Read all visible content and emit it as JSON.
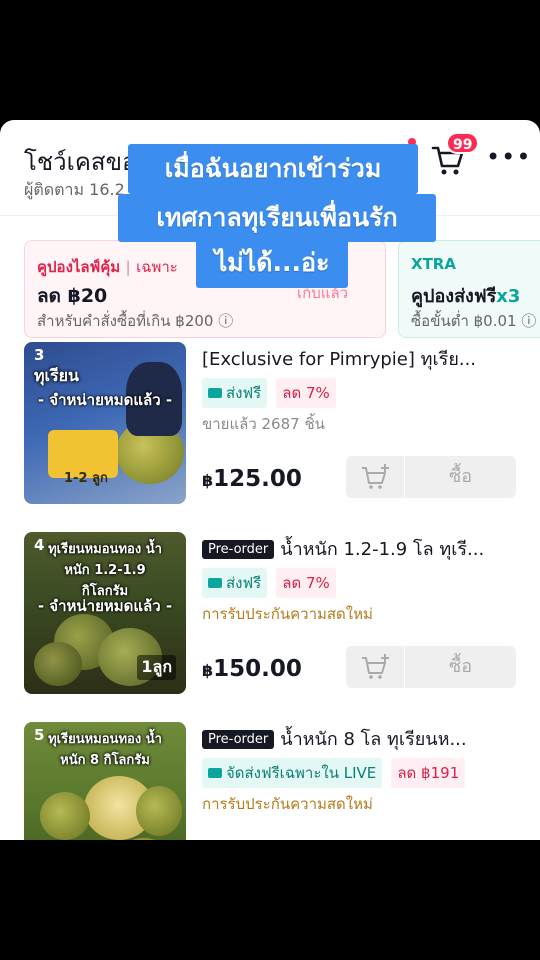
{
  "header": {
    "title": "โชว์เคสขอ",
    "followers": "ผู้ติดตาม 16.2",
    "cart_badge": "99"
  },
  "coupons": [
    {
      "tag": "คูปองไลฟ์คุ้ม",
      "tag2": "เฉพาะ",
      "main": "ลด ฿20",
      "note": "สำหรับคำสั่งซื้อที่เกิน ฿200 ⓘ",
      "status": "เก็บแล้ว"
    },
    {
      "tag": "XTRA",
      "main": "คูปองส่งฟรี",
      "multiplier": "x3",
      "note": "ซื้อขั้นต่ำ ฿0.01 ⓘ"
    }
  ],
  "products": [
    {
      "rank": "3",
      "thumb_title": "ทุเรียน",
      "sold_out": "- จำหน่ายหมดแล้ว -",
      "qty": "1-2 ลูก",
      "badge": "",
      "title": "[Exclusive for Pimrypie] ทุเรีย...",
      "tags": [
        "ส่งฟรี",
        "ลด 7%"
      ],
      "sub": "ขายแล้ว 2687 ชิ้น",
      "currency": "฿",
      "price": "125.00",
      "buy_label": "ซื้อ"
    },
    {
      "rank": "4",
      "thumb_title": "ทุเรียนหมอนทอง น้ำหนัก 1.2-1.9 กิโลกรัม",
      "sold_out": "- จำหน่ายหมดแล้ว -",
      "qty": "1ลูก",
      "badge": "Pre-order",
      "title": "น้ำหนัก 1.2-1.9 โล ทุเรี...",
      "tags": [
        "ส่งฟรี",
        "ลด 7%"
      ],
      "sub": "การรับประกันความสดใหม่",
      "currency": "฿",
      "price": "150.00",
      "buy_label": "ซื้อ"
    },
    {
      "rank": "5",
      "thumb_title": "ทุเรียนหมอนทอง น้ำหนัก 8 กิโลกรัม",
      "sold_out": "",
      "qty": "",
      "badge": "Pre-order",
      "title": "น้ำหนัก 8 โล  ทุเรียนห...",
      "tags": [
        "จัดส่งฟรีเฉพาะใน LIVE",
        "ลด ฿191"
      ],
      "sub": "การรับประกันความสดใหม่",
      "currency": "",
      "price": "",
      "buy_label": ""
    }
  ],
  "overlay_caption": [
    "เมื่อฉันอยากเข้าร่วม",
    "เทศกาลทุเรียนเพื่อนรัก",
    "ไม่ได้...อ่ะ"
  ],
  "colors": {
    "accent": "#fe2c55",
    "teal": "#0aa59b",
    "caption_bg": "#3b8ef0"
  }
}
